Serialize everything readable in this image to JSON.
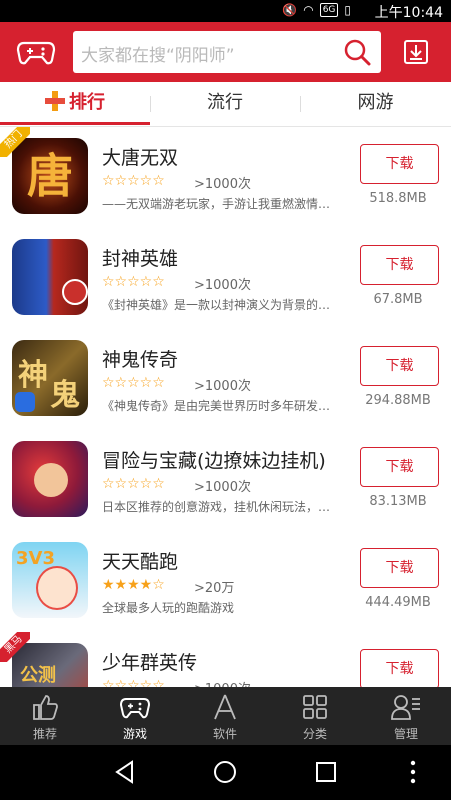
{
  "status_bar": {
    "network": "6G",
    "time": "上午10:44"
  },
  "header": {
    "search_placeholder": "大家都在搜“阴阳师”"
  },
  "tabs": [
    {
      "label": "排行",
      "active": true
    },
    {
      "label": "流行",
      "active": false
    },
    {
      "label": "网游",
      "active": false
    }
  ],
  "accent_color": "#d6212f",
  "list": [
    {
      "name": "大唐无双",
      "stars": "☆☆☆☆☆",
      "rating": 0,
      "count": ">1000次",
      "desc": "——无双端游老玩家，手游让我重燃激情…",
      "size": "518.8MB",
      "button": "下载",
      "badge": "热门"
    },
    {
      "name": "封神英雄",
      "stars": "☆☆☆☆☆",
      "rating": 0,
      "count": ">1000次",
      "desc": "《封神英雄》是一款以封神演义为背景的…",
      "size": "67.8MB",
      "button": "下载",
      "badge": ""
    },
    {
      "name": "神鬼传奇",
      "stars": "☆☆☆☆☆",
      "rating": 0,
      "count": ">1000次",
      "desc": "《神鬼传奇》是由完美世界历时多年研发…",
      "size": "294.88MB",
      "button": "下载",
      "badge": ""
    },
    {
      "name": "冒险与宝藏(边撩妹边挂机)",
      "stars": "☆☆☆☆☆",
      "rating": 0,
      "count": ">1000次",
      "desc": "日本区推荐的创意游戏，挂机休闲玩法，…",
      "size": "83.13MB",
      "button": "下载",
      "badge": ""
    },
    {
      "name": "天天酷跑",
      "stars": "★★★★☆",
      "rating": 4,
      "count": ">20万",
      "desc": "全球最多人玩的跑酷游戏",
      "size": "444.49MB",
      "button": "下载",
      "badge": ""
    },
    {
      "name": "少年群英传",
      "stars": "☆☆☆☆☆",
      "rating": 0,
      "count": ">1000次",
      "desc": "",
      "size": "",
      "button": "下载",
      "badge": "黑马"
    }
  ],
  "bottom_nav": [
    {
      "label": "推荐",
      "icon": "thumbs-up-icon",
      "active": false
    },
    {
      "label": "游戏",
      "icon": "gamepad-icon",
      "active": true
    },
    {
      "label": "软件",
      "icon": "app-store-icon",
      "active": false
    },
    {
      "label": "分类",
      "icon": "grid-icon",
      "active": false
    },
    {
      "label": "管理",
      "icon": "user-manage-icon",
      "active": false
    }
  ]
}
